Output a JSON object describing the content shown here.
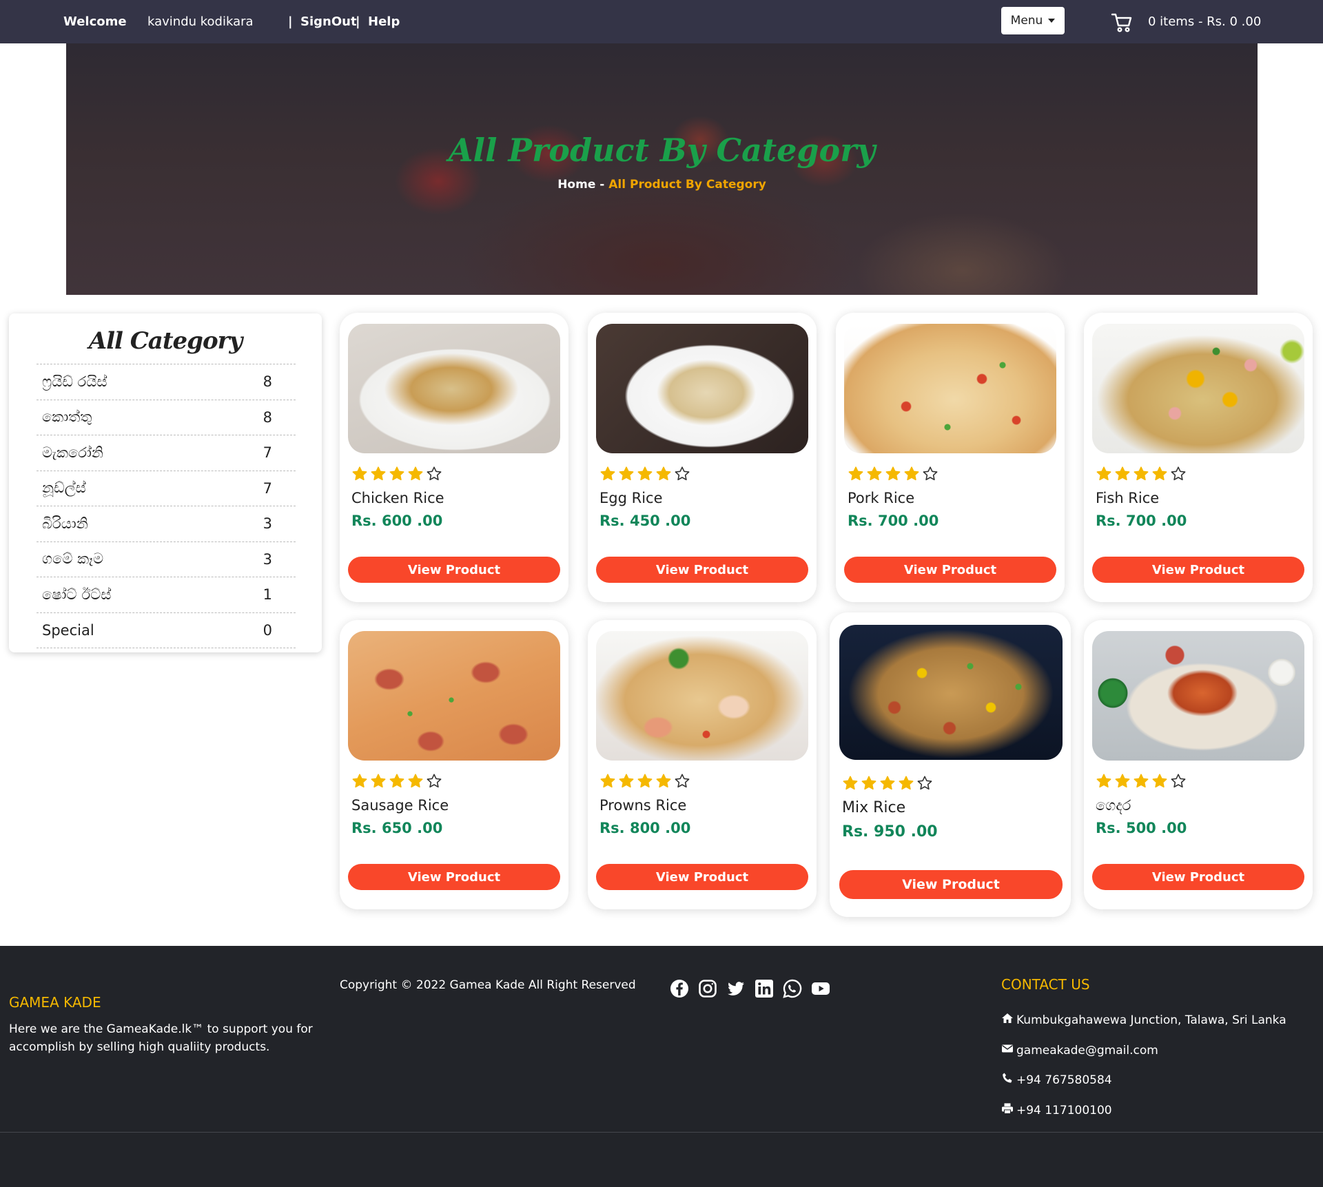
{
  "topbar": {
    "welcome": "Welcome",
    "user": "kavindu kodikara",
    "signout": "SignOut",
    "help": "Help",
    "separator": "|",
    "menu_label": "Menu",
    "cart_summary": "0 items - Rs. 0 .00"
  },
  "hero": {
    "title": "All Product By Category",
    "breadcrumb_home": "Home",
    "breadcrumb_sep": "-",
    "breadcrumb_current": "All Product By Category"
  },
  "sidebar": {
    "title": "All Category",
    "categories": [
      {
        "name": "ෆ්‍රයිඩ් රයිස්",
        "count": "8"
      },
      {
        "name": "කොත්තු",
        "count": "8"
      },
      {
        "name": "මැකරෝනි",
        "count": "7"
      },
      {
        "name": "නූඩ්ල්ස්",
        "count": "7"
      },
      {
        "name": "බිරියානි",
        "count": "3"
      },
      {
        "name": "ගමේ කෑම",
        "count": "3"
      },
      {
        "name": "ෂෝට් ඊට්ස්",
        "count": "1"
      },
      {
        "name": "Special",
        "count": "0"
      }
    ]
  },
  "products": [
    {
      "name": "Chicken Rice",
      "price": "Rs. 600 .00",
      "rating": 4,
      "button": "View Product"
    },
    {
      "name": "Egg Rice",
      "price": "Rs. 450 .00",
      "rating": 4,
      "button": "View Product"
    },
    {
      "name": "Pork Rice",
      "price": "Rs. 700 .00",
      "rating": 4,
      "button": "View Product"
    },
    {
      "name": "Fish Rice",
      "price": "Rs. 700 .00",
      "rating": 4,
      "button": "View Product"
    },
    {
      "name": "Sausage Rice",
      "price": "Rs. 650 .00",
      "rating": 4,
      "button": "View Product"
    },
    {
      "name": "Prowns Rice",
      "price": "Rs. 800 .00",
      "rating": 4,
      "button": "View Product"
    },
    {
      "name": "Mix Rice",
      "price": "Rs. 950 .00",
      "rating": 4,
      "button": "View Product"
    },
    {
      "name": "ගෙදර",
      "price": "Rs. 500 .00",
      "rating": 4,
      "button": "View Product"
    }
  ],
  "footer": {
    "brand": "GAMEA KADE",
    "about": "Here we are the GameaKade.lk™ to support you for accomplish by selling high qualiity products.",
    "copyright": "Copyright © 2022 Gamea Kade All Right Reserved",
    "socials": [
      "facebook-icon",
      "instagram-icon",
      "twitter-icon",
      "linkedin-icon",
      "whatsapp-icon",
      "youtube-icon"
    ],
    "contact_title": "CONTACT US",
    "address": "Kumbukgahawewa Junction, Talawa, Sri Lanka",
    "email": "gameakade@gmail.com",
    "phone": "+94 767580584",
    "fax": "+94 117100100"
  },
  "colors": {
    "topbar": "#343447",
    "accent_green": "#1aa04a",
    "price_green": "#12865a",
    "button_orange": "#f9472a",
    "star_yellow": "#f5b800",
    "footer_bg": "#222429"
  }
}
